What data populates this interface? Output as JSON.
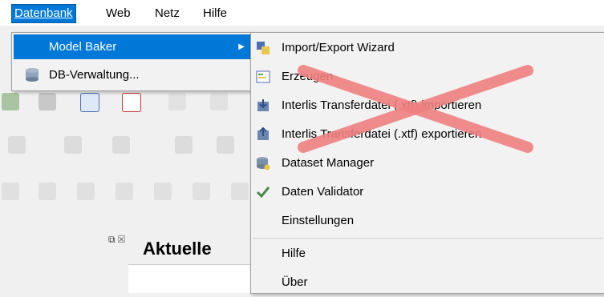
{
  "menubar": {
    "items": [
      {
        "label": "Datenbank"
      },
      {
        "label": "Web"
      },
      {
        "label": "Netz"
      },
      {
        "label": "Hilfe"
      }
    ]
  },
  "datenbank_menu": {
    "items": [
      {
        "label": "Model Baker",
        "has_submenu": true,
        "icon": "none"
      },
      {
        "label": "DB-Verwaltung...",
        "has_submenu": false,
        "icon": "database-icon"
      }
    ]
  },
  "model_baker_submenu": {
    "items": [
      {
        "label": "Import/Export Wizard",
        "icon": "wizard-icon"
      },
      {
        "label": "Erzeugen",
        "icon": "generate-icon"
      },
      {
        "label": "Interlis Transferdatei (.xtf) importieren",
        "icon": "import-icon"
      },
      {
        "label": "Interlis Transferdatei (.xtf) exportieren",
        "icon": "export-icon"
      },
      {
        "label": "Dataset Manager",
        "icon": "dataset-icon"
      },
      {
        "label": "Daten Validator",
        "icon": "checkmark-icon"
      },
      {
        "label": "Einstellungen",
        "icon": "none"
      },
      {
        "label": "Hilfe",
        "icon": "none"
      },
      {
        "label": "Über",
        "icon": "none"
      }
    ]
  },
  "panel": {
    "title": "Aktuelle",
    "dock_buttons": "⧉ ☒"
  },
  "colors": {
    "highlight": "#0078d7",
    "menu_bg": "#f2f2f2",
    "cross": "#f08080"
  }
}
